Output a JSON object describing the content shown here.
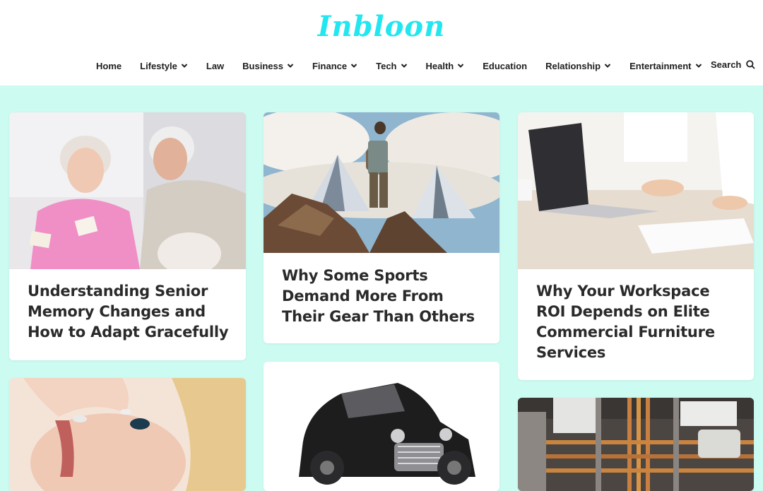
{
  "site": {
    "logo": "Inbloon"
  },
  "nav": {
    "items": [
      {
        "label": "Home",
        "dropdown": false
      },
      {
        "label": "Lifestyle",
        "dropdown": true
      },
      {
        "label": "Law",
        "dropdown": false
      },
      {
        "label": "Business",
        "dropdown": true
      },
      {
        "label": "Finance",
        "dropdown": true
      },
      {
        "label": "Tech",
        "dropdown": true
      },
      {
        "label": "Health",
        "dropdown": true
      },
      {
        "label": "Education",
        "dropdown": false
      },
      {
        "label": "Relationship",
        "dropdown": true
      },
      {
        "label": "Entertainment",
        "dropdown": true
      }
    ],
    "search_label": "Search"
  },
  "articles": [
    {
      "title": "Understanding Senior Memory Changes and How to Adapt Gracefully",
      "image": "elderly-couple-photo"
    },
    {
      "title": "Why Some Sports Demand More From Their Gear Than Others",
      "image": "mountain-hiker-photo"
    },
    {
      "title": "Why Your Workspace ROI Depends on Elite Commercial Furniture Services",
      "image": "laptop-desk-photo"
    },
    {
      "title": "",
      "image": "woman-face-photo"
    },
    {
      "title": "",
      "image": "vintage-car-photo"
    },
    {
      "title": "",
      "image": "copper-pipes-photo"
    }
  ],
  "colors": {
    "background": "#ccfbf1",
    "logo": "#22e6f0",
    "text": "#2a2a2a"
  }
}
